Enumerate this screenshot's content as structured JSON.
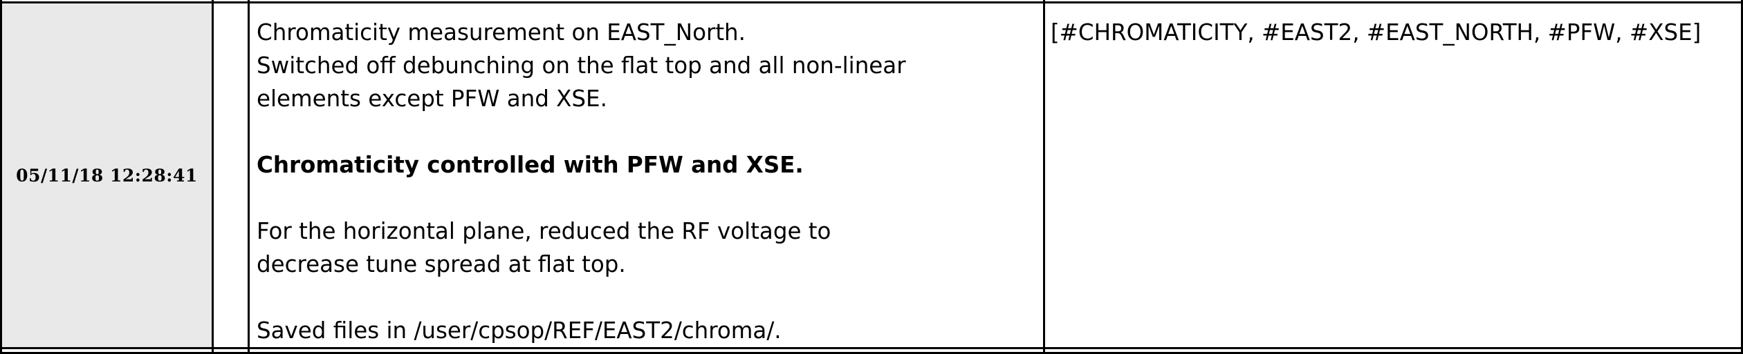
{
  "entry": {
    "timestamp": "05/11/18 12:28:41",
    "text": {
      "para1": {
        "line1": "Chromaticity measurement on EAST_North.",
        "line2": "Switched off debunching on the flat top and all non-linear",
        "line3": "elements except PFW and XSE."
      },
      "heading": "Chromaticity controlled with PFW and XSE.",
      "para2": {
        "line1": "For the horizontal plane, reduced the RF voltage to",
        "line2": "decrease tune spread at flat top."
      },
      "para3": {
        "line1": "Saved files in /user/cpsop/REF/EAST2/chroma/."
      }
    },
    "tags": "[#CHROMATICITY, #EAST2, #EAST_NORTH, #PFW, #XSE]"
  }
}
